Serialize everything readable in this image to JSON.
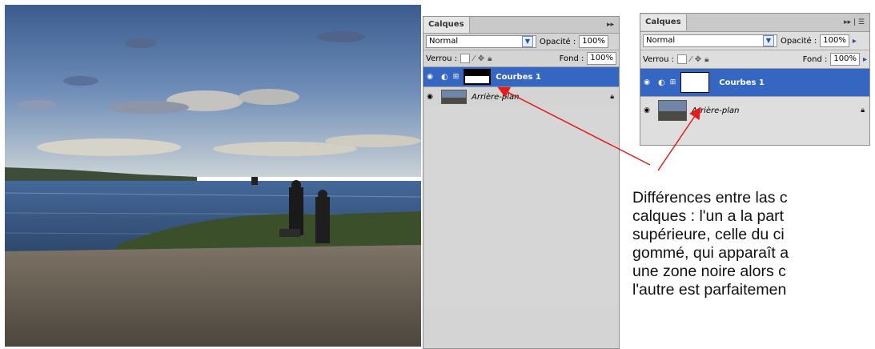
{
  "panel_left": {
    "tab_title": "Calques",
    "blend_mode": "Normal",
    "opacity_label": "Opacité :",
    "opacity_value": "100%",
    "lock_label": "Verrou :",
    "fill_label": "Fond :",
    "fill_value": "100%",
    "layers": [
      {
        "name": "Courbes 1",
        "selected": true
      },
      {
        "name": "Arrière-plan",
        "selected": false
      }
    ]
  },
  "panel_right": {
    "tab_title": "Calques",
    "blend_mode": "Normal",
    "opacity_label": "Opacité :",
    "opacity_value": "100%",
    "lock_label": "Verrou :",
    "fill_label": "Fond :",
    "fill_value": "100%",
    "layers": [
      {
        "name": "Courbes 1",
        "selected": true
      },
      {
        "name": "Arrière-plan",
        "selected": false
      }
    ]
  },
  "annotation": {
    "lines": [
      "Différences entre las c",
      "calques : l'un a la part",
      "supérieure, celle du ci",
      "gommé, qui apparaît a",
      "une zone noire alors c",
      "l'autre est parfaitemen"
    ]
  },
  "colors": {
    "selected_layer": "#3567c2",
    "arrow": "#e31b1b",
    "panel_bg": "#d4d4d4"
  }
}
